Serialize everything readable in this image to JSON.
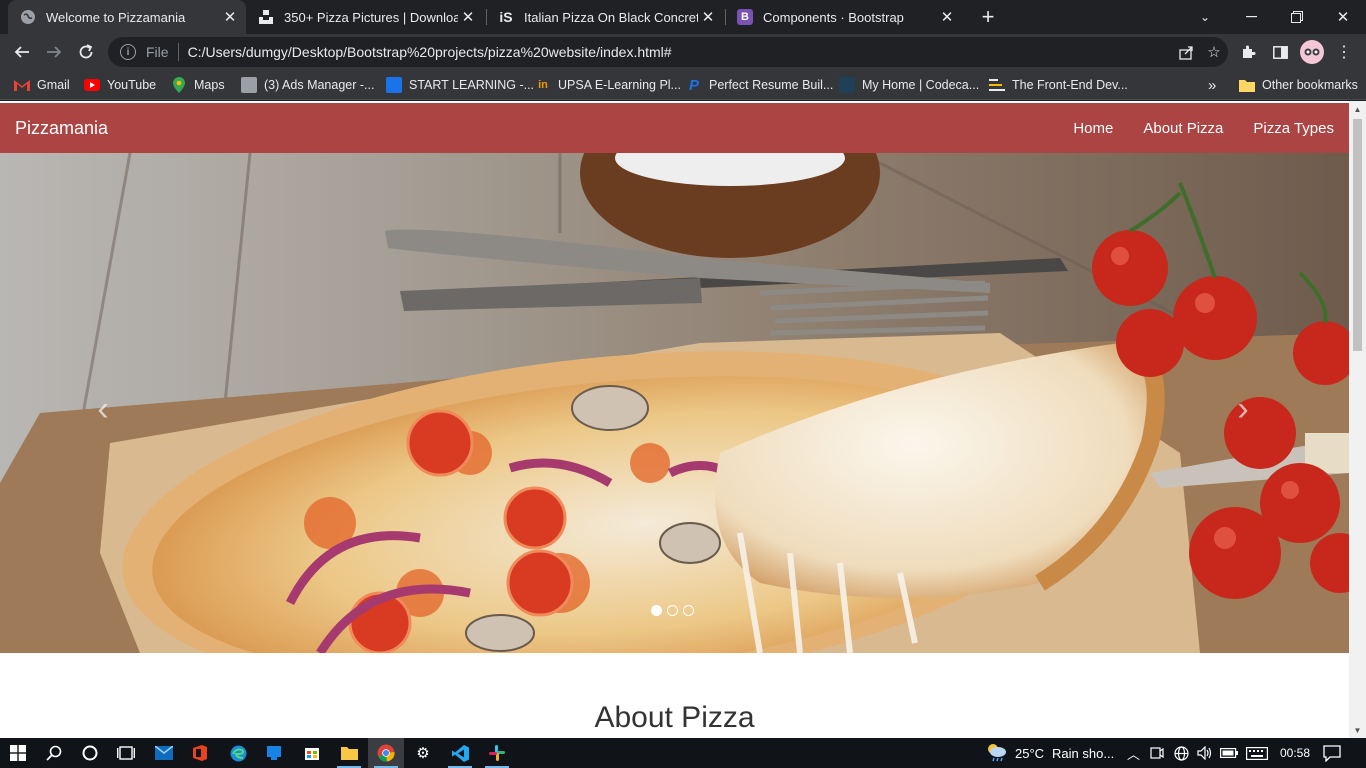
{
  "browser": {
    "tabs": [
      {
        "title": "Welcome to Pizzamania",
        "icon": "globe-icon",
        "active": true
      },
      {
        "title": "350+ Pizza Pictures | Download F",
        "icon": "unsplash-icon",
        "active": false
      },
      {
        "title": "Italian Pizza On Black Concrete B",
        "icon": "istock-icon",
        "active": false
      },
      {
        "title": "Components · Bootstrap",
        "icon": "bootstrap-icon",
        "active": false
      }
    ],
    "new_tab_label": "+",
    "address": {
      "scheme_label": "File",
      "url": "C:/Users/dumgy/Desktop/Bootstrap%20projects/pizza%20website/index.html#"
    },
    "bookmarks": [
      {
        "label": "Gmail",
        "icon": "gmail-icon",
        "color": "#ea4335"
      },
      {
        "label": "YouTube",
        "icon": "youtube-icon",
        "color": "#ff0000"
      },
      {
        "label": "Maps",
        "icon": "maps-icon",
        "color": "#34a853"
      },
      {
        "label": "(3) Ads Manager -...",
        "icon": "ads-manager-icon",
        "color": "#9aa0a6"
      },
      {
        "label": "START LEARNING -...",
        "icon": "start-learning-icon",
        "color": "#1a73e8"
      },
      {
        "label": "UPSA E-Learning Pl...",
        "icon": "upsa-icon",
        "color": "#f29900"
      },
      {
        "label": "Perfect Resume Buil...",
        "icon": "resume-icon",
        "color": "#1a73e8"
      },
      {
        "label": "My Home | Codeca...",
        "icon": "codecademy-icon",
        "color": "#1f4056"
      },
      {
        "label": "The Front-End Dev...",
        "icon": "frontend-icon",
        "color": "#e8eaed"
      }
    ],
    "bookmarks_overflow": "»",
    "other_bookmarks": "Other bookmarks"
  },
  "site": {
    "brand": "Pizzamania",
    "nav": [
      "Home",
      "About Pizza",
      "Pizza Types"
    ],
    "nav_color": "#ad4444",
    "carousel": {
      "slide_count": 3,
      "active_index": 0,
      "prev_label": "‹",
      "next_label": "›"
    },
    "section_title": "About Pizza"
  },
  "taskbar": {
    "weather": {
      "temp": "25°C",
      "text": "Rain sho..."
    },
    "time": "00:58"
  }
}
